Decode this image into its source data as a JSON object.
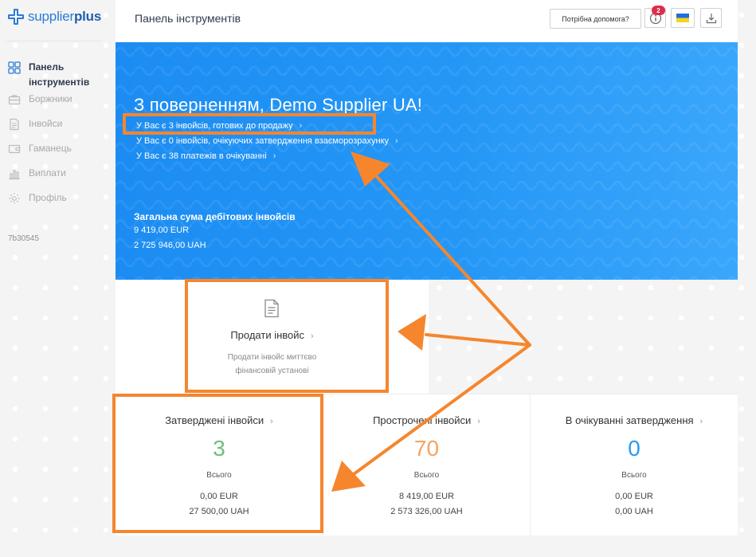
{
  "app": {
    "logo_text": "supplier",
    "logo_bold": "plus",
    "version": "7b30545"
  },
  "sidebar": {
    "items": [
      {
        "label": "Панель інструментів",
        "icon": "dashboard-icon",
        "active": true
      },
      {
        "label": "Боржники",
        "icon": "briefcase-icon",
        "active": false
      },
      {
        "label": "Інвойси",
        "icon": "document-icon",
        "active": false
      },
      {
        "label": "Гаманець",
        "icon": "wallet-icon",
        "active": false
      },
      {
        "label": "Виплати",
        "icon": "bar-chart-icon",
        "active": false
      },
      {
        "label": "Профіль",
        "icon": "gear-icon",
        "active": false
      }
    ]
  },
  "header": {
    "title": "Панель інструментів",
    "help_label": "Потрібна допомога?",
    "notifications_count": "2",
    "language_flag": "flag-ua-icon",
    "download_icon": "download-icon"
  },
  "banner": {
    "welcome": "З поверненням, Demo Supplier UA!",
    "links": [
      "У Вас є 3 інвойсів, готових до продажу",
      "У Вас є 0 інвойсів, очікуючих затвердження взаєморозрахунку",
      "У Вас є 38 платежів в очікуванні"
    ],
    "total_label": "Загальна сума дебітових інвойсів",
    "totals": [
      "9 419,00 EUR",
      "2 725 946,00 UAH"
    ]
  },
  "sell_tile": {
    "title": "Продати інвойс",
    "description": "Продати інвойс миттєво фінансовій установі",
    "icon": "document-icon"
  },
  "stats": [
    {
      "title": "Затверджені інвойси",
      "value": "3",
      "sub": "Всього",
      "amounts": [
        "0,00 EUR",
        "27 500,00 UAH"
      ],
      "color": "#6cc07a"
    },
    {
      "title": "Прострочені інвойси",
      "value": "70",
      "sub": "Всього",
      "amounts": [
        "8 419,00 EUR",
        "2 573 326,00 UAH"
      ],
      "color": "#f4a462"
    },
    {
      "title": "В очікуванні затвердження",
      "value": "0",
      "sub": "Всього",
      "amounts": [
        "0,00 EUR",
        "0,00 UAH"
      ],
      "color": "#2a9bf0"
    }
  ],
  "colors": {
    "accent": "#1c8cf2",
    "annotation": "#f5862e",
    "badge": "#e02b4a"
  }
}
